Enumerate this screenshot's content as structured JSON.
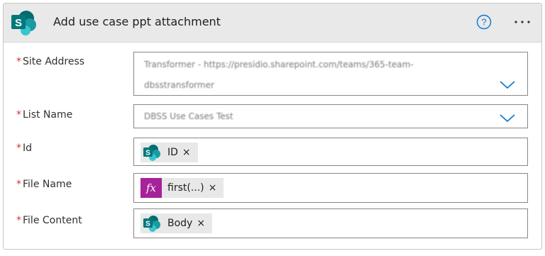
{
  "header": {
    "title": "Add use case ppt attachment",
    "help_icon": "help-circle-icon",
    "more_icon": "more-ellipsis-icon",
    "logo_icon": "sharepoint-logo-icon",
    "colors": {
      "header_bg": "#e9e9e9",
      "accent": "#0078d4",
      "sharepoint": "#038387",
      "required": "#d13438",
      "expression": "#a7219a"
    }
  },
  "fields": {
    "site_address": {
      "required_mark": "*",
      "label": "Site Address",
      "value_line1": "Transformer - https://presidio.sharepoint.com/teams/365-team-",
      "value_line2": "dbsstransformer"
    },
    "list_name": {
      "required_mark": "*",
      "label": "List Name",
      "value": "DBSS Use Cases Test"
    },
    "id": {
      "required_mark": "*",
      "label": "Id",
      "token": {
        "text": "ID",
        "close": "×",
        "icon": "sharepoint-icon"
      }
    },
    "file_name": {
      "required_mark": "*",
      "label": "File Name",
      "token": {
        "text": "first(...)",
        "close": "×",
        "icon": "fx-expression-icon",
        "icon_glyph": "fx"
      }
    },
    "file_content": {
      "required_mark": "*",
      "label": "File Content",
      "token": {
        "text": "Body",
        "close": "×",
        "icon": "sharepoint-icon"
      }
    }
  }
}
